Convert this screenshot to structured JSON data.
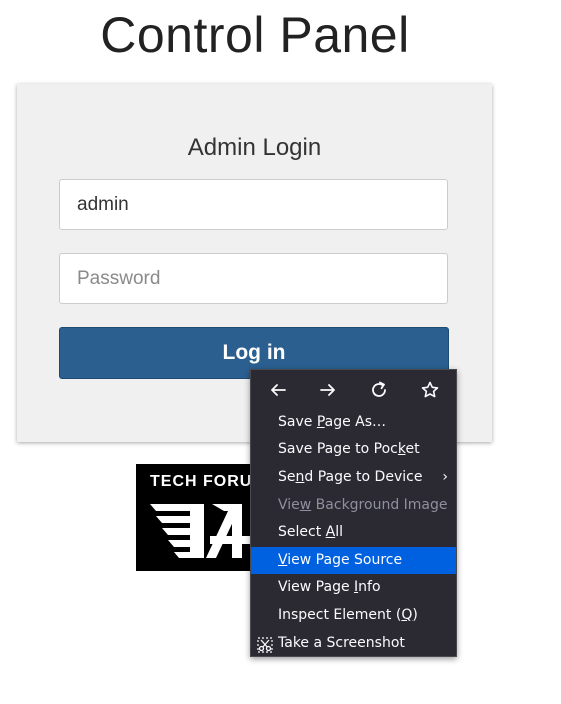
{
  "page": {
    "title": "Control Panel"
  },
  "login": {
    "heading": "Admin Login",
    "username_value": "admin",
    "password_placeholder": "Password",
    "login_button_label": "Log in"
  },
  "logo": {
    "text": "TECH FORUM"
  },
  "context_menu": {
    "nav_icons": [
      "back-arrow-icon",
      "forward-arrow-icon",
      "reload-icon",
      "bookmark-star-icon"
    ],
    "items": [
      {
        "pre": "Save ",
        "key": "P",
        "post": "age As…",
        "enabled": true,
        "highlighted": false
      },
      {
        "pre": "Save Page to Poc",
        "key": "k",
        "post": "et",
        "enabled": true,
        "highlighted": false
      },
      {
        "pre": "Se",
        "key": "n",
        "post": "d Page to Device",
        "enabled": true,
        "highlighted": false,
        "submenu": true
      },
      {
        "pre": "Vie",
        "key": "w",
        "post": " Background Image",
        "enabled": false,
        "highlighted": false
      },
      {
        "pre": "Select ",
        "key": "A",
        "post": "ll",
        "enabled": true,
        "highlighted": false
      },
      {
        "pre": "",
        "key": "V",
        "post": "iew Page Source",
        "enabled": true,
        "highlighted": true
      },
      {
        "pre": "View Page ",
        "key": "I",
        "post": "nfo",
        "enabled": true,
        "highlighted": false
      },
      {
        "pre": "Inspect Element (",
        "key": "Q",
        "post": ")",
        "enabled": true,
        "highlighted": false
      },
      {
        "pre": "Take a Screenshot",
        "key": "",
        "post": "",
        "enabled": true,
        "highlighted": false,
        "icon": "screenshot-scissors-icon"
      }
    ],
    "submenu_arrow": "›"
  },
  "colors": {
    "menu_background": "#2b2a33",
    "menu_highlight": "#0061e0",
    "login_button": "#2b5f90"
  }
}
